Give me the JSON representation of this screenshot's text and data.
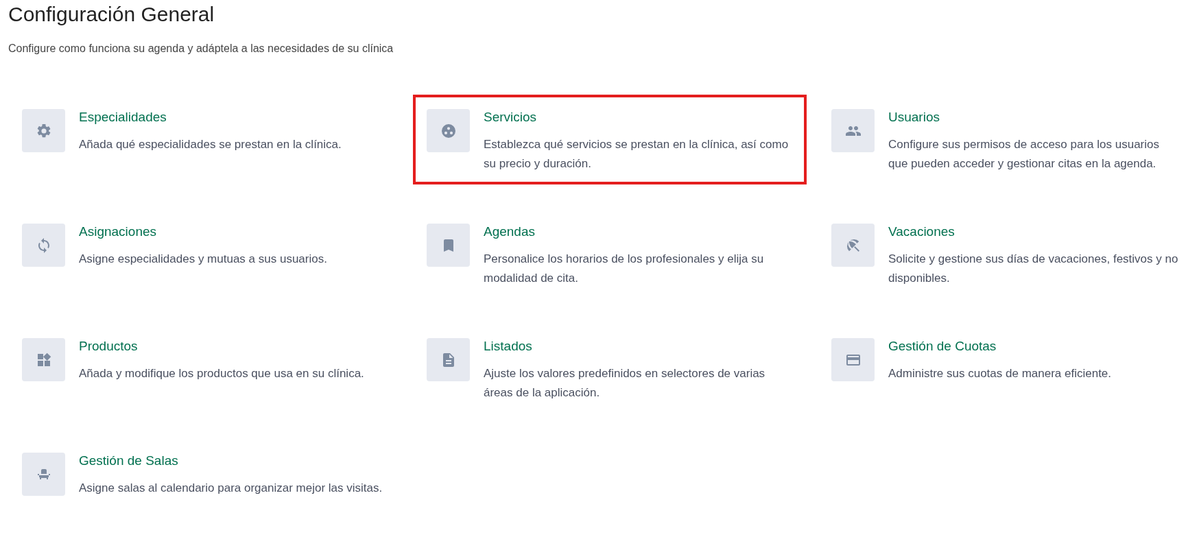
{
  "page": {
    "title": "Configuración General",
    "subtitle": "Configure como funciona su agenda y adáptela a las necesidades de su clínica"
  },
  "sections": [
    {
      "title": "Especialidades",
      "description": "Añada qué especialidades se prestan en la clínica.",
      "highlighted": false
    },
    {
      "title": "Servicios",
      "description": "Establezca qué servicios se prestan en la clínica, así como su precio y duración.",
      "highlighted": true
    },
    {
      "title": "Usuarios",
      "description": "Configure sus permisos de acceso para los usuarios que pueden acceder y gestionar citas en la agenda.",
      "highlighted": false
    },
    {
      "title": "Asignaciones",
      "description": "Asigne especialidades y mutuas a sus usuarios.",
      "highlighted": false
    },
    {
      "title": "Agendas",
      "description": "Personalice los horarios de los profesionales y elija su modalidad de cita.",
      "highlighted": false
    },
    {
      "title": "Vacaciones",
      "description": "Solicite y gestione sus días de vacaciones, festivos y no disponibles.",
      "highlighted": false
    },
    {
      "title": "Productos",
      "description": "Añada y modifique los productos que usa en su clínica.",
      "highlighted": false
    },
    {
      "title": "Listados",
      "description": "Ajuste los valores predefinidos en selectores de varias áreas de la aplicación.",
      "highlighted": false
    },
    {
      "title": "Gestión de Cuotas",
      "description": "Administre sus cuotas de manera eficiente.",
      "highlighted": false
    },
    {
      "title": "Gestión de Salas",
      "description": "Asigne salas al calendario para organizar mejor las visitas.",
      "highlighted": false
    }
  ]
}
